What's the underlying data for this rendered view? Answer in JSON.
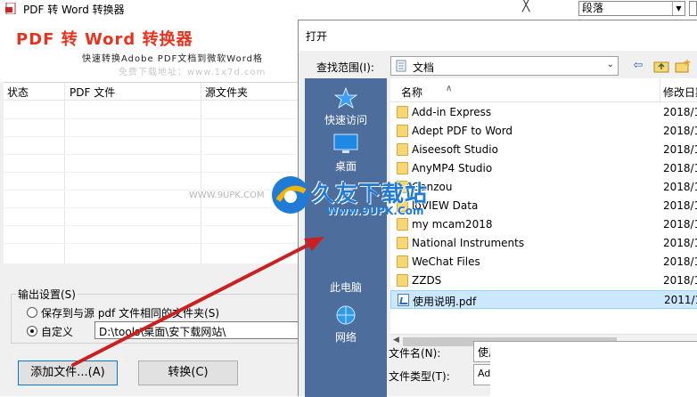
{
  "app": {
    "title": "PDF 转 Word 转换器",
    "banner_title": "PDF 转 Word 转换器",
    "banner_subtitle": "快速转换Adobe PDF文档到微软Word格",
    "banner_watermark": "免费下载地址：www.1x7d.com",
    "close_glyph": "╳",
    "columns": [
      "状态",
      "PDF 文件",
      "源文件夹"
    ],
    "output": {
      "legend": "输出设置(S)",
      "option_same": "保存到与源 pdf 文件相同的文件夹(S)",
      "option_custom": "自定义",
      "custom_path": "D:\\tools\\桌面\\安下载网站\\"
    },
    "buttons": {
      "add": "添加文件...(A)",
      "convert": "转换(C)"
    }
  },
  "background": {
    "style_select": "段落"
  },
  "dialog": {
    "title": "打开",
    "lookin_label": "查找范围(I):",
    "lookin_value": "文档",
    "places": [
      "快速访问",
      "桌面",
      "此电脑",
      "网络"
    ],
    "columns": {
      "name": "名称",
      "modified": "修改日期"
    },
    "files": [
      {
        "name": "Add-in Express",
        "date": "2018/1",
        "type": "folder"
      },
      {
        "name": "Adept PDF to Word",
        "date": "2018/1",
        "type": "folder"
      },
      {
        "name": "Aiseesoft Studio",
        "date": "2018/1",
        "type": "folder"
      },
      {
        "name": "AnyMP4 Studio",
        "date": "2018/1",
        "type": "folder"
      },
      {
        "name": "Ganzou",
        "date": "2018/1",
        "type": "folder"
      },
      {
        "name": "loVIEW Data",
        "date": "2018/1",
        "type": "folder"
      },
      {
        "name": "my mcam2018",
        "date": "2018/1",
        "type": "folder"
      },
      {
        "name": "National Instruments",
        "date": "2018/1",
        "type": "folder"
      },
      {
        "name": "WeChat Files",
        "date": "2018/1",
        "type": "folder"
      },
      {
        "name": "ZZDS",
        "date": "2018/1",
        "type": "folder"
      },
      {
        "name": "使用说明.pdf",
        "date": "2011/1",
        "type": "pdf"
      }
    ],
    "filename_label": "文件名(N):",
    "filename_value": "使用",
    "filetype_label": "文件类型(T):",
    "filetype_value": "Ado"
  },
  "watermark": {
    "title": "久友下载站",
    "url": "Www.9UPK.Com",
    "left_text": "WWW.9UPK.COM"
  },
  "colors": {
    "banner_red": "#e8331f",
    "places_blue": "#4d6e9c",
    "selection": "#cce8ff",
    "arrow_red": "#cc1f1f",
    "watermark_blue": "#1f7bd6"
  }
}
